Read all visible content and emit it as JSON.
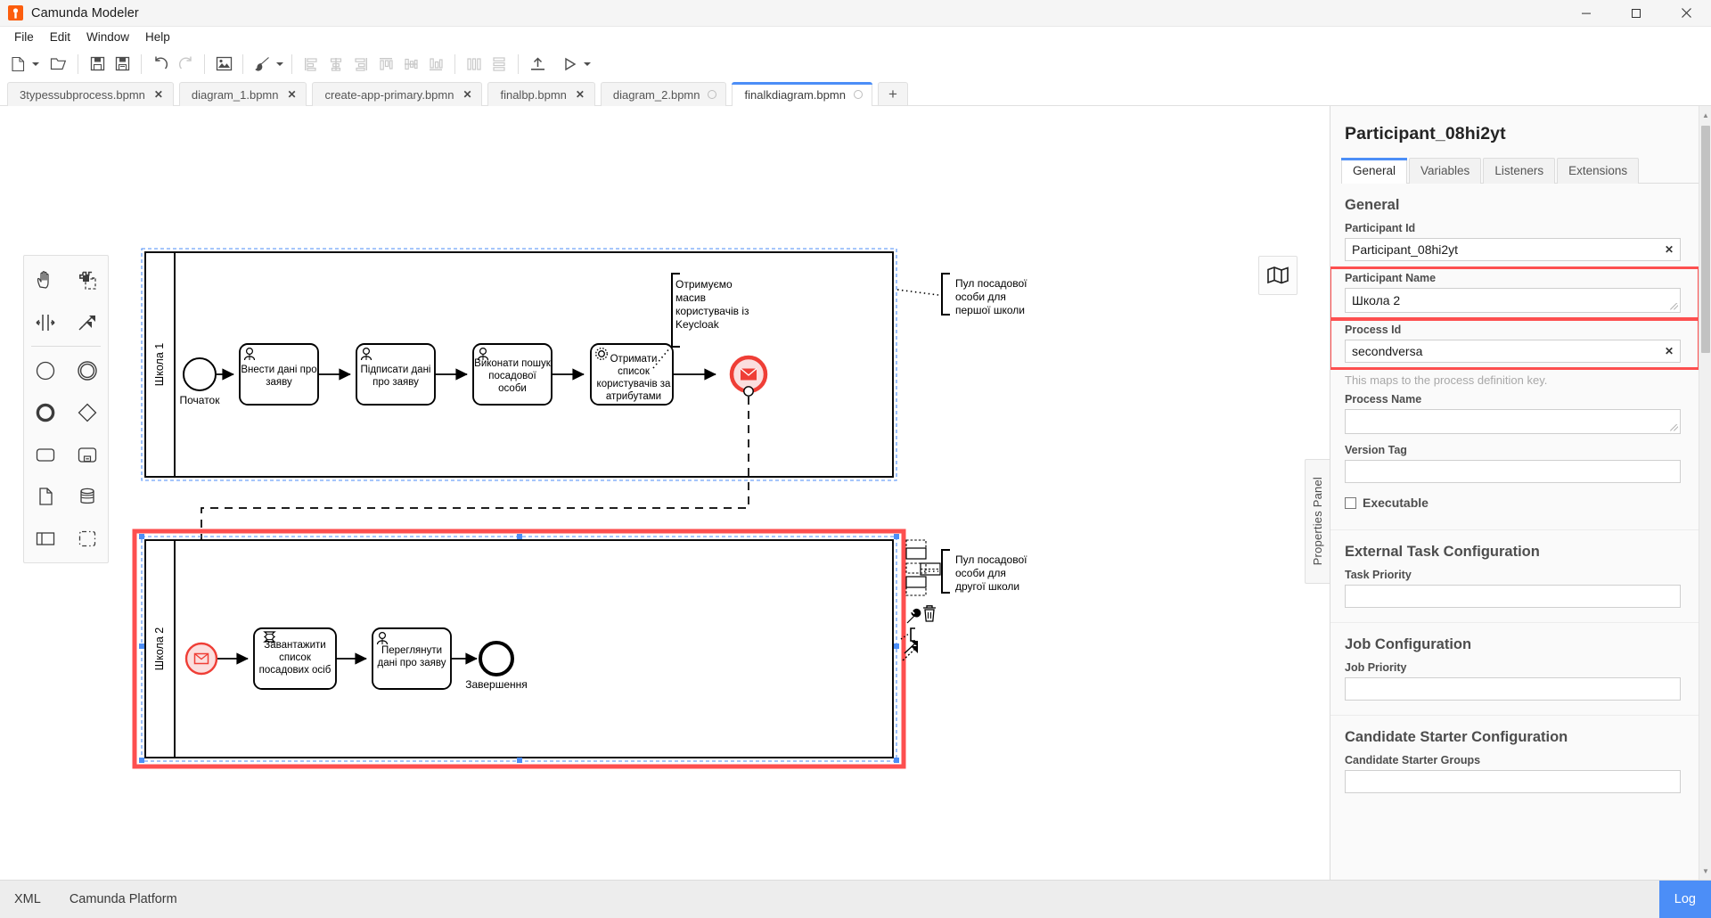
{
  "window": {
    "title": "Camunda Modeler",
    "logo_icon": "camunda-logo",
    "minimize_icon": "minimize-icon",
    "maximize_icon": "maximize-icon",
    "close_icon": "close-icon"
  },
  "menubar": {
    "items": [
      "File",
      "Edit",
      "Window",
      "Help"
    ]
  },
  "toolbar": {
    "groups": [
      {
        "buttons": [
          {
            "name": "new-file-button",
            "icon": "file-icon",
            "caret": true,
            "disabled": false
          },
          {
            "name": "open-file-button",
            "icon": "folder-open-icon",
            "caret": false,
            "disabled": false
          }
        ]
      },
      {
        "buttons": [
          {
            "name": "save-button",
            "icon": "save-icon",
            "caret": false,
            "disabled": false
          },
          {
            "name": "save-as-button",
            "icon": "save-as-icon",
            "caret": false,
            "disabled": false
          }
        ]
      },
      {
        "buttons": [
          {
            "name": "undo-button",
            "icon": "undo-icon",
            "caret": false,
            "disabled": false
          },
          {
            "name": "redo-button",
            "icon": "redo-icon",
            "caret": false,
            "disabled": true
          }
        ]
      },
      {
        "buttons": [
          {
            "name": "export-image-button",
            "icon": "image-icon",
            "caret": false,
            "disabled": false
          }
        ]
      },
      {
        "buttons": [
          {
            "name": "toggle-color-picker-button",
            "icon": "paint-brush-icon",
            "caret": true,
            "disabled": false
          }
        ]
      },
      {
        "buttons": [
          {
            "name": "align-left-button",
            "icon": "align-left-icon",
            "caret": false,
            "disabled": true
          },
          {
            "name": "align-center-button",
            "icon": "align-center-icon",
            "caret": false,
            "disabled": true
          },
          {
            "name": "align-right-button",
            "icon": "align-right-icon",
            "caret": false,
            "disabled": true
          },
          {
            "name": "align-top-button",
            "icon": "align-top-icon",
            "caret": false,
            "disabled": true
          },
          {
            "name": "align-middle-button",
            "icon": "align-middle-icon",
            "caret": false,
            "disabled": true
          },
          {
            "name": "align-bottom-button",
            "icon": "align-bottom-icon",
            "caret": false,
            "disabled": true
          }
        ]
      },
      {
        "buttons": [
          {
            "name": "distribute-horizontally-button",
            "icon": "distribute-horizontal-icon",
            "caret": false,
            "disabled": true
          },
          {
            "name": "distribute-vertically-button",
            "icon": "distribute-vertical-icon",
            "caret": false,
            "disabled": true
          }
        ]
      },
      {
        "buttons": [
          {
            "name": "deploy-button",
            "icon": "deploy-upload-icon",
            "caret": false,
            "disabled": false
          }
        ]
      },
      {
        "buttons": [
          {
            "name": "start-instance-button",
            "icon": "play-icon",
            "caret": true,
            "disabled": false
          }
        ]
      }
    ]
  },
  "tabs": {
    "items": [
      {
        "label": "3typessubprocess.bpmn",
        "active": false,
        "state": "close"
      },
      {
        "label": "diagram_1.bpmn",
        "active": false,
        "state": "close"
      },
      {
        "label": "create-app-primary.bpmn",
        "active": false,
        "state": "close"
      },
      {
        "label": "finalbp.bpmn",
        "active": false,
        "state": "close"
      },
      {
        "label": "diagram_2.bpmn",
        "active": false,
        "state": "dirty"
      },
      {
        "label": "finalkdiagram.bpmn",
        "active": true,
        "state": "dirty"
      }
    ],
    "add_label": "+",
    "close_glyph": "✕"
  },
  "palette": {
    "rows": [
      [
        {
          "name": "hand-tool-icon"
        },
        {
          "name": "lasso-tool-icon"
        }
      ],
      [
        {
          "name": "space-tool-icon"
        },
        {
          "name": "connect-tool-icon"
        }
      ]
    ],
    "shape_rows": [
      [
        {
          "name": "start-event-icon"
        },
        {
          "name": "intermediate-event-icon"
        }
      ],
      [
        {
          "name": "end-event-icon"
        },
        {
          "name": "gateway-icon"
        }
      ],
      [
        {
          "name": "task-icon"
        },
        {
          "name": "subprocess-icon"
        }
      ],
      [
        {
          "name": "data-object-icon"
        },
        {
          "name": "data-store-icon"
        }
      ],
      [
        {
          "name": "participant-pool-icon"
        },
        {
          "name": "group-icon"
        }
      ]
    ]
  },
  "canvas": {
    "minimap_icon": "map-icon",
    "properties_panel_handle": "Properties Panel",
    "pools": [
      {
        "name": "Школа 1",
        "selected": false,
        "elements": [
          {
            "type": "startEvent",
            "label": "Початок"
          },
          {
            "type": "userTask",
            "label": "Внести дані про заяву"
          },
          {
            "type": "userTask",
            "label": "Підписати дані про заяву"
          },
          {
            "type": "userTask",
            "label": "Виконати пошук посадової особи"
          },
          {
            "type": "serviceTask",
            "label": "Отримати список користувачів за атрибутами"
          },
          {
            "type": "messageEndEvent",
            "label": ""
          }
        ],
        "annotations": [
          {
            "text": "Отримуємо масив користувачів із Keycloak"
          },
          {
            "text": "Пул посадової особи для першої школи"
          }
        ]
      },
      {
        "name": "Школа 2",
        "selected": true,
        "elements": [
          {
            "type": "messageStartEvent",
            "label": ""
          },
          {
            "type": "scriptTask",
            "label": "Завантажити список посадових осіб"
          },
          {
            "type": "userTask",
            "label": "Переглянути дані про заяву"
          },
          {
            "type": "endEvent",
            "label": "Завершення"
          }
        ],
        "annotations": [
          {
            "text": "Пул посадової особи для другої школи"
          }
        ]
      }
    ],
    "context_pad": {
      "items": [
        {
          "name": "append-lane-above-icon"
        },
        {
          "name": "append-lane-below-icon"
        },
        {
          "name": "divide-lanes-icon"
        },
        {
          "name": "wrench-replace-icon"
        },
        {
          "name": "trash-delete-icon"
        },
        {
          "name": "append-text-annotation-icon"
        },
        {
          "name": "connect-arrow-icon"
        }
      ]
    }
  },
  "properties": {
    "title": "Participant_08hi2yt",
    "tabs": [
      {
        "label": "General",
        "active": true
      },
      {
        "label": "Variables",
        "active": false
      },
      {
        "label": "Listeners",
        "active": false
      },
      {
        "label": "Extensions",
        "active": false
      }
    ],
    "groups": [
      {
        "heading": "General",
        "fields": [
          {
            "label": "Participant Id",
            "value": "Participant_08hi2yt",
            "clear": true,
            "highlight": false,
            "kind": "input"
          },
          {
            "label": "Participant Name",
            "value": "Школа 2",
            "clear": false,
            "highlight": true,
            "kind": "textarea"
          },
          {
            "label": "Process Id",
            "value": "secondversa",
            "clear": true,
            "highlight": true,
            "kind": "input"
          }
        ],
        "hint": "This maps to the process definition key.",
        "fields2": [
          {
            "label": "Process Name",
            "value": "",
            "clear": false,
            "highlight": false,
            "kind": "textarea"
          },
          {
            "label": "Version Tag",
            "value": "",
            "clear": false,
            "highlight": false,
            "kind": "input"
          }
        ],
        "checkbox": {
          "label": "Executable",
          "checked": false
        }
      },
      {
        "heading": "External Task Configuration",
        "fields": [
          {
            "label": "Task Priority",
            "value": "",
            "clear": false,
            "highlight": false,
            "kind": "input"
          }
        ]
      },
      {
        "heading": "Job Configuration",
        "fields": [
          {
            "label": "Job Priority",
            "value": "",
            "clear": false,
            "highlight": false,
            "kind": "input"
          }
        ]
      },
      {
        "heading": "Candidate Starter Configuration",
        "fields": [
          {
            "label": "Candidate Starter Groups",
            "value": "",
            "clear": false,
            "highlight": false,
            "kind": "input"
          }
        ]
      }
    ]
  },
  "statusbar": {
    "items": [
      "XML",
      "Camunda Platform"
    ],
    "log_label": "Log"
  },
  "colors": {
    "accent": "#4c8ef7",
    "brand_orange": "#fc5d0d",
    "highlight_red": "#fd4f4f",
    "message_event_red": "#e53935",
    "selection_blue": "#4c8ef7"
  }
}
